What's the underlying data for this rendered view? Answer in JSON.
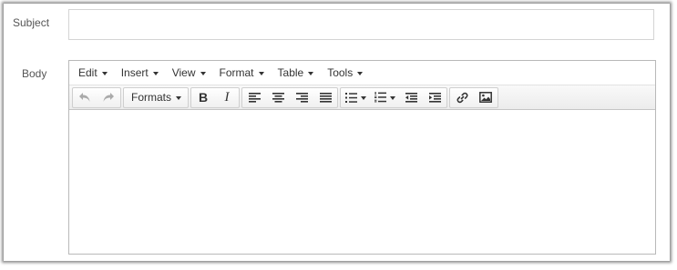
{
  "form": {
    "subject_label": "Subject",
    "subject_value": "",
    "body_label": "Body"
  },
  "editor": {
    "menus": [
      {
        "label": "Edit"
      },
      {
        "label": "Insert"
      },
      {
        "label": "View"
      },
      {
        "label": "Format"
      },
      {
        "label": "Table"
      },
      {
        "label": "Tools"
      }
    ],
    "toolbar": {
      "formats_label": "Formats",
      "icons": [
        "undo-icon",
        "redo-icon",
        "bold-icon",
        "italic-icon",
        "align-left-icon",
        "align-center-icon",
        "align-right-icon",
        "align-justify-icon",
        "bullet-list-icon",
        "numbered-list-icon",
        "outdent-icon",
        "indent-icon",
        "link-icon",
        "image-icon"
      ]
    },
    "content": ""
  },
  "colors": {
    "frame_shadow": "#555555",
    "label": "#555555",
    "text": "#333333",
    "disabled_icon": "#aaaaaa",
    "editor_border": "#b9b9b9"
  }
}
